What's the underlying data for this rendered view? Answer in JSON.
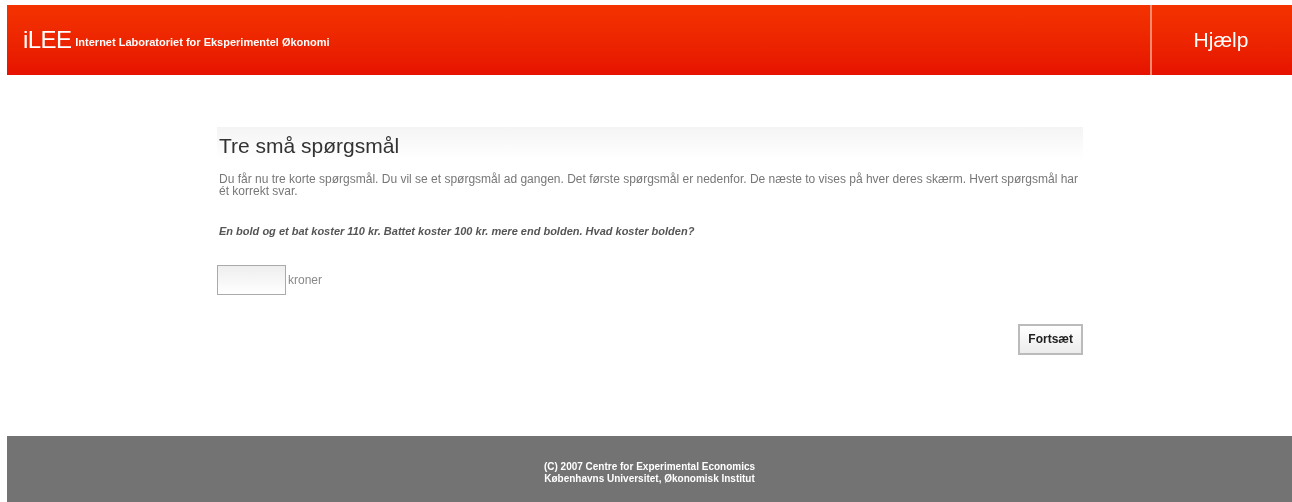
{
  "header": {
    "logo": "iLEE",
    "tagline": "Internet Laboratoriet for Eksperimentel Økonomi",
    "help": "Hjælp"
  },
  "title": "Tre små spørgsmål",
  "intro": "Du får nu tre korte spørgsmål. Du vil se et spørgsmål ad gangen. Det første spørgsmål er nedenfor. De næste to vises på hver deres skærm. Hvert spørgsmål har ét korrekt svar.",
  "question": "En bold og et bat koster 110 kr. Battet koster 100 kr. mere end bolden. Hvad koster bolden?",
  "answer": {
    "unit": "kroner"
  },
  "continue_button": "Fortsæt",
  "footer": [
    "(C) 2007 Centre for Experimental Economics",
    "Københavns Universitet, Økonomisk Institut"
  ]
}
